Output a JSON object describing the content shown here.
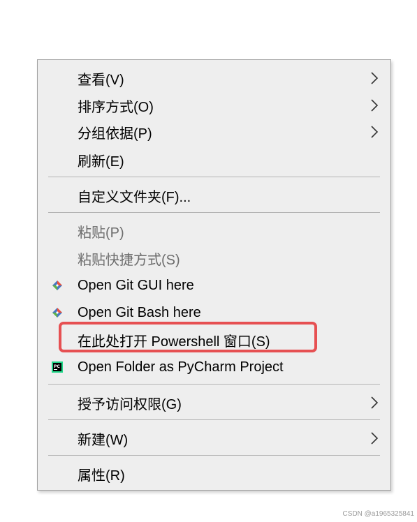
{
  "menu": {
    "items": [
      {
        "label": "查看(V)",
        "submenu": true
      },
      {
        "label": "排序方式(O)",
        "submenu": true
      },
      {
        "label": "分组依据(P)",
        "submenu": true
      },
      {
        "label": "刷新(E)"
      },
      {
        "label": "自定义文件夹(F)..."
      },
      {
        "label": "粘贴(P)",
        "disabled": true
      },
      {
        "label": "粘贴快捷方式(S)",
        "disabled": true
      },
      {
        "label": "Open Git GUI here",
        "icon": "git-icon"
      },
      {
        "label": "Open Git Bash here",
        "icon": "git-icon"
      },
      {
        "label": "在此处打开 Powershell 窗口(S)",
        "highlighted": true
      },
      {
        "label": "Open Folder as PyCharm Project",
        "icon": "pycharm-icon"
      },
      {
        "label": "授予访问权限(G)",
        "submenu": true
      },
      {
        "label": "新建(W)",
        "submenu": true
      },
      {
        "label": "属性(R)"
      }
    ]
  },
  "highlight_color": "#e65052",
  "watermark": "CSDN @a1965325841"
}
